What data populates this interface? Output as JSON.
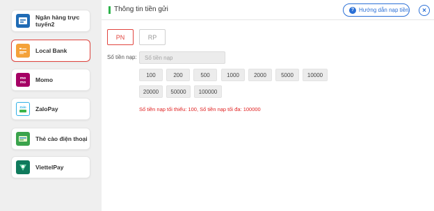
{
  "sidebar": {
    "items": [
      {
        "label": "Ngân hàng trực tuyến2",
        "icon": "online-bank-icon",
        "color": "#1f6bb5",
        "active": false
      },
      {
        "label": "Local Bank",
        "icon": "local-bank-icon",
        "color": "#f4a23a",
        "active": true
      },
      {
        "label": "Momo",
        "icon": "momo-icon",
        "color": "#a50064",
        "active": false
      },
      {
        "label": "ZaloPay",
        "icon": "zalopay-icon",
        "color": "#2db0e6",
        "active": false
      },
      {
        "label": "Thẻ cào điện thoại",
        "icon": "phone-card-icon",
        "color": "#3aa34c",
        "active": false
      },
      {
        "label": "ViettelPay",
        "icon": "viettelpay-icon",
        "color": "#0f7a5c",
        "active": false
      }
    ]
  },
  "header": {
    "title": "Thông tin tiền gửi",
    "guide_label": "Hướng dẫn nạp tiền",
    "close_label": "×"
  },
  "tabs": [
    {
      "label": "PN",
      "active": true
    },
    {
      "label": "RP",
      "active": false
    }
  ],
  "amount": {
    "label": "Số tiền nạp:",
    "placeholder": "Số tiền nạp",
    "value": ""
  },
  "quick_amounts": [
    "100",
    "200",
    "500",
    "1000",
    "2000",
    "5000",
    "10000",
    "20000",
    "50000",
    "100000"
  ],
  "limit_text": "Số tiền nạp tối thiểu:  100,  Số tiền nạp tối đa:  100000",
  "colors": {
    "accent_red": "#e0433d",
    "accent_blue": "#2a6fd6",
    "title_green": "#2db24a",
    "limit_red": "#e02020"
  }
}
